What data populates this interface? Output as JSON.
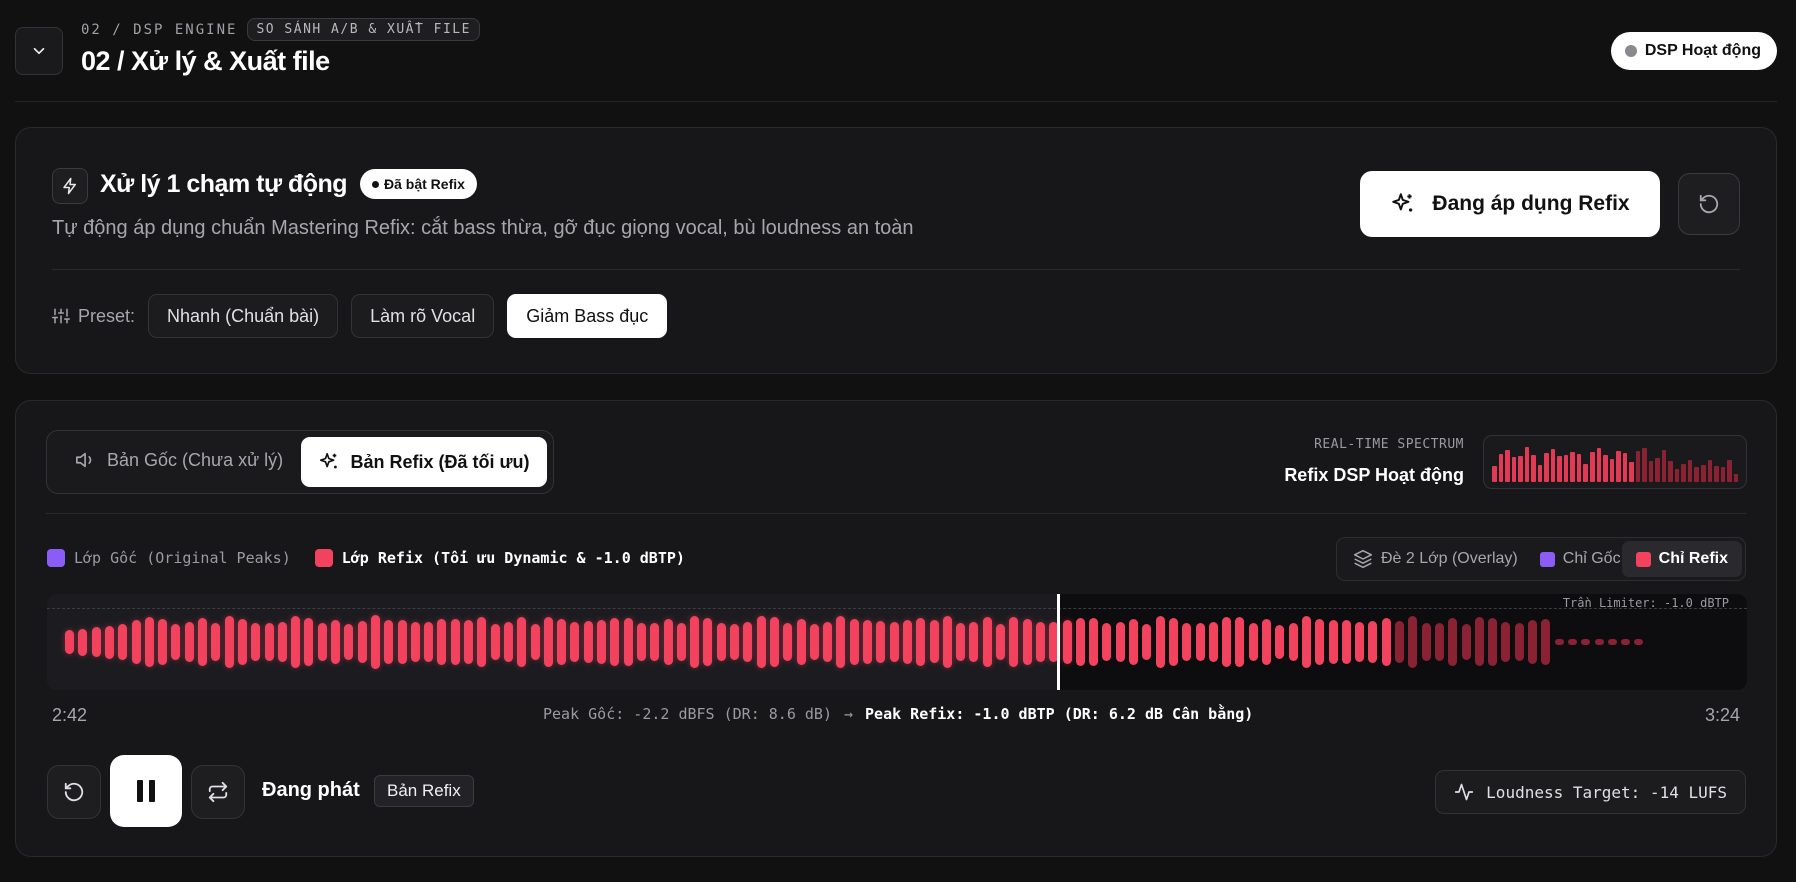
{
  "header": {
    "section_code": "02 / DSP ENGINE",
    "tag": "SO SÁNH A/B & XUẤT FILE",
    "title": "02 / Xử lý & Xuất file",
    "status": "DSP Hoạt động"
  },
  "auto": {
    "title": "Xử lý 1 chạm tự động",
    "badge": "Đã bật Refix",
    "description": "Tự động áp dụng chuẩn Mastering Refix: cắt bass thừa, gỡ đục giọng vocal, bù loudness an toàn",
    "apply_label": "Đang áp dụng Refix",
    "preset_label": "Preset:",
    "presets": [
      "Nhanh (Chuẩn bài)",
      "Làm rõ Vocal",
      "Giảm Bass đục"
    ],
    "active_preset": "Giảm Bass đục"
  },
  "compare": {
    "original_tab": "Bản Gốc (Chưa xử lý)",
    "refix_tab": "Bản Refix (Đã tối ưu)",
    "spectrum_label": "REAL-TIME SPECTRUM",
    "spectrum_status": "Refix DSP Hoạt động",
    "legend_original": "Lớp Gốc (Original Peaks)",
    "legend_refix": "Lớp Refix (Tối ưu Dynamic & -1.0 dBTP)",
    "view_overlay": "Đè 2 Lớp (Overlay)",
    "view_original": "Chỉ Gốc",
    "view_refix": "Chỉ Refix",
    "limiter_label": "Trần Limiter: -1.0 dBTP",
    "time_start": "2:42",
    "time_end": "3:24",
    "peak_original": "Peak Gốc: -2.2 dBFS (DR: 8.6 dB)",
    "arrow": "→",
    "peak_refix": "Peak Refix: -1.0 dBTP (DR: 6.2 dB Cân bằng)"
  },
  "player": {
    "status": "Đang phát",
    "version_badge": "Bản Refix",
    "loudness": "Loudness Target: -14 LUFS",
    "progress": 0.6
  },
  "colors": {
    "refix": "#f2425e",
    "refix_dim": "#8a2233",
    "original": "#8b5cf6",
    "panel": "#17171a"
  }
}
